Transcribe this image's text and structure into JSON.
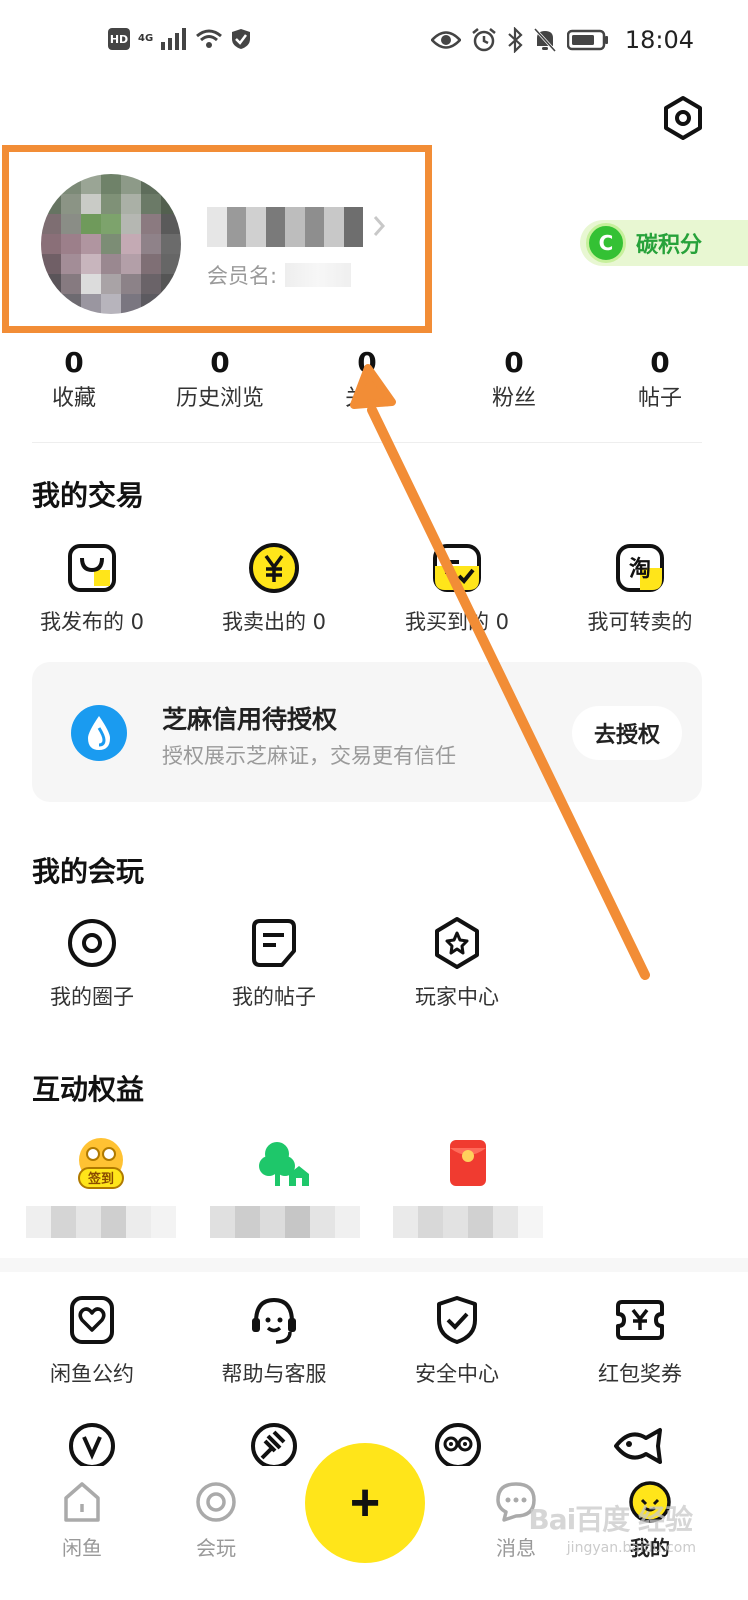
{
  "status_bar": {
    "hd_badge": "HD",
    "network": "4G",
    "time": "18:04"
  },
  "profile": {
    "member_label": "会员名:",
    "carbon_icon": "C",
    "carbon_label": "碳积分"
  },
  "stats": [
    {
      "value": "0",
      "label": "收藏"
    },
    {
      "value": "0",
      "label": "历史浏览"
    },
    {
      "value": "0",
      "label": "关注"
    },
    {
      "value": "0",
      "label": "粉丝"
    },
    {
      "value": "0",
      "label": "帖子"
    }
  ],
  "trade": {
    "title": "我的交易",
    "items": [
      {
        "label": "我发布的 0",
        "icon": "bag-icon"
      },
      {
        "label": "我卖出的 0",
        "icon": "yen-coin-icon"
      },
      {
        "label": "我买到的 0",
        "icon": "purchased-check-icon"
      },
      {
        "label": "我可转卖的",
        "icon": "taobao-icon"
      }
    ]
  },
  "zhima": {
    "title": "芝麻信用待授权",
    "subtitle": "授权展示芝麻证，交易更有信任",
    "button": "去授权"
  },
  "play": {
    "title": "我的会玩",
    "items": [
      {
        "label": "我的圈子",
        "icon": "circle-icon"
      },
      {
        "label": "我的帖子",
        "icon": "post-icon"
      },
      {
        "label": "玩家中心",
        "icon": "star-hexagon-icon"
      }
    ]
  },
  "benefits": {
    "title": "互动权益",
    "items": [
      {
        "badge": "签到",
        "icon": "checkin-icon"
      },
      {
        "icon": "green-tree-icon"
      },
      {
        "icon": "red-packet-icon"
      }
    ]
  },
  "services": {
    "items": [
      {
        "label": "闲鱼公约",
        "icon": "heart-doc-icon"
      },
      {
        "label": "帮助与客服",
        "icon": "customer-service-icon"
      },
      {
        "label": "安全中心",
        "icon": "shield-check-icon"
      },
      {
        "label": "红包奖券",
        "icon": "coupon-yen-icon"
      }
    ]
  },
  "bottom_nav": {
    "items": [
      {
        "label": "闲鱼",
        "icon": "home-icon"
      },
      {
        "label": "会玩",
        "icon": "play-circle-icon"
      },
      {
        "label": "消息",
        "icon": "message-icon"
      },
      {
        "label": "我的",
        "icon": "profile-face-icon"
      }
    ],
    "publish": "+"
  },
  "watermark": {
    "main": "Bai百度 经验",
    "sub": "jingyan.baidu.com"
  },
  "colors": {
    "accent_yellow": "#ffe51a",
    "annotation_orange": "#f28d36",
    "carbon_green": "#27a23a",
    "zhima_blue": "#1a9bf0"
  }
}
